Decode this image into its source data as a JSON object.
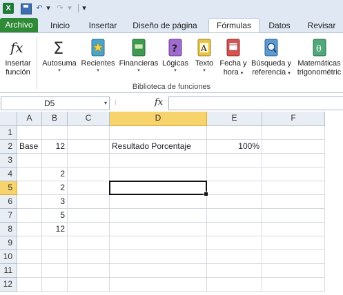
{
  "qat": {
    "app_icon": "X",
    "save_icon": "save-icon",
    "undo_icon": "↶",
    "redo_icon": "↷",
    "dropdown": "▾"
  },
  "tabs": [
    "Archivo",
    "Inicio",
    "Insertar",
    "Diseño de página",
    "Fórmulas",
    "Datos",
    "Revisar"
  ],
  "active_tab": "Fórmulas",
  "ribbon": {
    "insert_function": {
      "line1": "Insertar",
      "line2": "función"
    },
    "buttons": [
      {
        "label": "Autosuma",
        "icon": "sum-icon",
        "arrow": "▾"
      },
      {
        "label": "Recientes",
        "icon": "recent-book-icon",
        "arrow": "▾"
      },
      {
        "label": "Financieras",
        "icon": "financial-book-icon",
        "arrow": "▾"
      },
      {
        "label": "Lógicas",
        "icon": "logical-book-icon",
        "arrow": "▾"
      },
      {
        "label": "Texto",
        "icon": "text-book-icon",
        "arrow": "▾"
      },
      {
        "label1": "Fecha y",
        "label2": "hora",
        "icon": "date-book-icon",
        "arrow": "▾"
      },
      {
        "label1": "Búsqueda y",
        "label2": "referencia",
        "icon": "lookup-book-icon",
        "arrow": "▾"
      },
      {
        "label1": "Matemáticas",
        "label2": "trigonométric",
        "icon": "math-book-icon"
      }
    ],
    "group_label": "Biblioteca de funciones",
    "icon_colors": {
      "recent": "#4aa3c9",
      "financial": "#3f9b52",
      "logical": "#a06ad0",
      "text": "#e8c24a",
      "date": "#d9534f",
      "lookup": "#5b9bd5",
      "math": "#4fa77a"
    }
  },
  "formula_bar": {
    "name_box": "D5",
    "fx": "fx",
    "formula": ""
  },
  "grid": {
    "columns": [
      "A",
      "B",
      "C",
      "D",
      "E",
      "F"
    ],
    "rows": [
      "1",
      "2",
      "3",
      "4",
      "5",
      "6",
      "7",
      "8",
      "9",
      "10",
      "11",
      "12"
    ],
    "selected_cell": "D5",
    "cells": {
      "A2": "Base",
      "B2": "12",
      "D2": "Resultado Porcentaje",
      "E2": "100%",
      "B4": "2",
      "B5": "2",
      "B6": "3",
      "B7": "5",
      "B8": "12"
    }
  }
}
